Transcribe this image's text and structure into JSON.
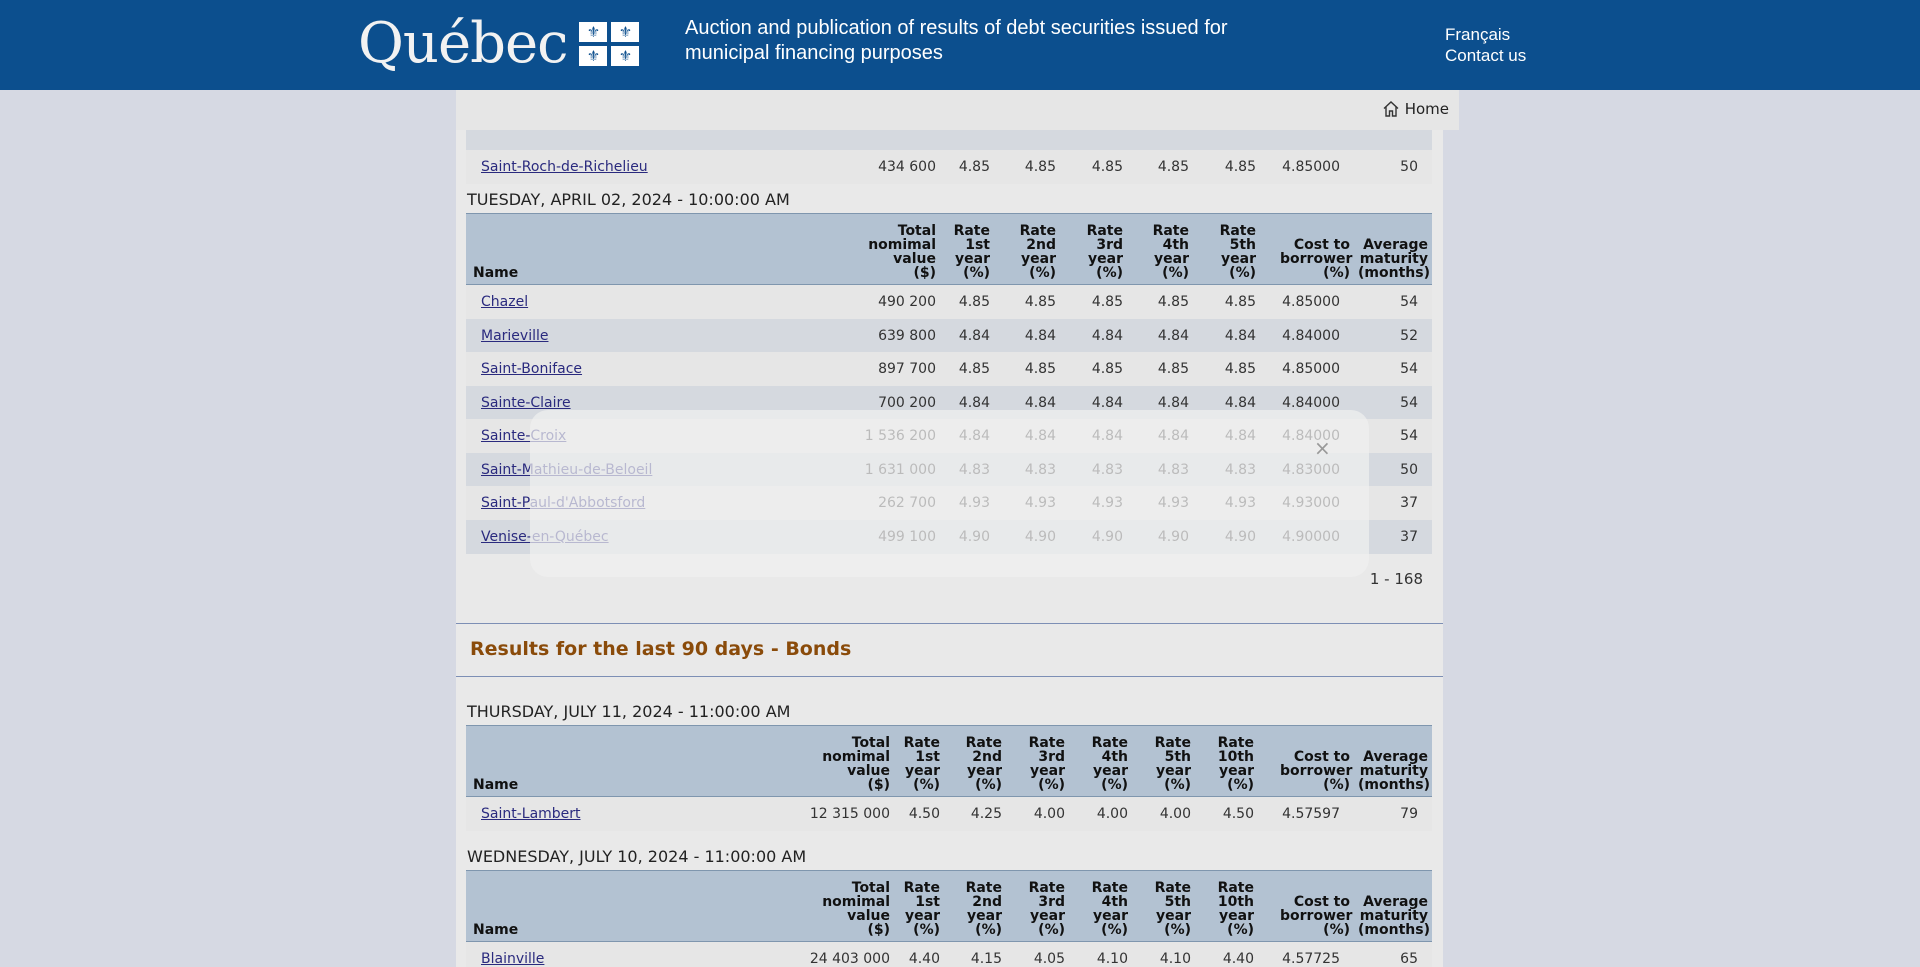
{
  "header": {
    "logo_text": "Québec",
    "title": "Auction and publication of results of debt securities issued for municipal financing purposes",
    "links": [
      "Français",
      "Contact us"
    ]
  },
  "nav": {
    "home_label": "Home"
  },
  "table1": {
    "last_row": {
      "name": "Saint-Roch-de-Richelieu",
      "values": [
        "434 600",
        "4.85",
        "4.85",
        "4.85",
        "4.85",
        "4.85",
        "4.85000",
        "50"
      ]
    }
  },
  "table2": {
    "date": "TUESDAY, APRIL 02, 2024 - 10:00:00 AM",
    "headers": [
      "Name",
      "Total nomimal value ($)",
      "Rate 1st year (%)",
      "Rate 2nd year (%)",
      "Rate 3rd year (%)",
      "Rate 4th year (%)",
      "Rate 5th year (%)",
      "Cost to borrower (%)",
      "Average maturity (months)"
    ],
    "rows": [
      {
        "name": "Chazel",
        "values": [
          "490 200",
          "4.85",
          "4.85",
          "4.85",
          "4.85",
          "4.85",
          "4.85000",
          "54"
        ]
      },
      {
        "name": "Marieville",
        "values": [
          "639 800",
          "4.84",
          "4.84",
          "4.84",
          "4.84",
          "4.84",
          "4.84000",
          "52"
        ]
      },
      {
        "name": "Saint-Boniface",
        "values": [
          "897 700",
          "4.85",
          "4.85",
          "4.85",
          "4.85",
          "4.85",
          "4.85000",
          "54"
        ]
      },
      {
        "name": "Sainte-Claire",
        "values": [
          "700 200",
          "4.84",
          "4.84",
          "4.84",
          "4.84",
          "4.84",
          "4.84000",
          "54"
        ]
      },
      {
        "name": "Sainte-Croix",
        "values": [
          "1 536 200",
          "4.84",
          "4.84",
          "4.84",
          "4.84",
          "4.84",
          "4.84000",
          "54"
        ]
      },
      {
        "name": "Saint-Mathieu-de-Beloeil",
        "values": [
          "1 631 000",
          "4.83",
          "4.83",
          "4.83",
          "4.83",
          "4.83",
          "4.83000",
          "50"
        ]
      },
      {
        "name": "Saint-Paul-d'Abbotsford",
        "values": [
          "262 700",
          "4.93",
          "4.93",
          "4.93",
          "4.93",
          "4.93",
          "4.93000",
          "37"
        ]
      },
      {
        "name": "Venise-en-Québec",
        "values": [
          "499 100",
          "4.90",
          "4.90",
          "4.90",
          "4.90",
          "4.90",
          "4.90000",
          "37"
        ]
      }
    ],
    "pager": "1 - 168"
  },
  "bonds_section": {
    "title": "Results for the last 90 days - Bonds"
  },
  "bonds_headers": [
    "Name",
    "Total nomimal value ($)",
    "Rate 1st year (%)",
    "Rate 2nd year (%)",
    "Rate 3rd year (%)",
    "Rate 4th year (%)",
    "Rate 5th year (%)",
    "Rate 10th year (%)",
    "Cost to borrower (%)",
    "Average maturity (months)"
  ],
  "bonds1": {
    "date": "THURSDAY, JULY 11, 2024 - 11:00:00 AM",
    "rows": [
      {
        "name": "Saint-Lambert",
        "values": [
          "12 315 000",
          "4.50",
          "4.25",
          "4.00",
          "4.00",
          "4.00",
          "4.50",
          "4.57597",
          "79"
        ]
      }
    ]
  },
  "bonds2": {
    "date": "WEDNESDAY, JULY 10, 2024 - 11:00:00 AM",
    "rows": [
      {
        "name": "Blainville",
        "values": [
          "24 403 000",
          "4.40",
          "4.15",
          "4.05",
          "4.10",
          "4.10",
          "4.40",
          "4.57725",
          "65"
        ]
      }
    ]
  },
  "overlay": {
    "close_icon": "close-icon",
    "close_glyph": "×"
  }
}
